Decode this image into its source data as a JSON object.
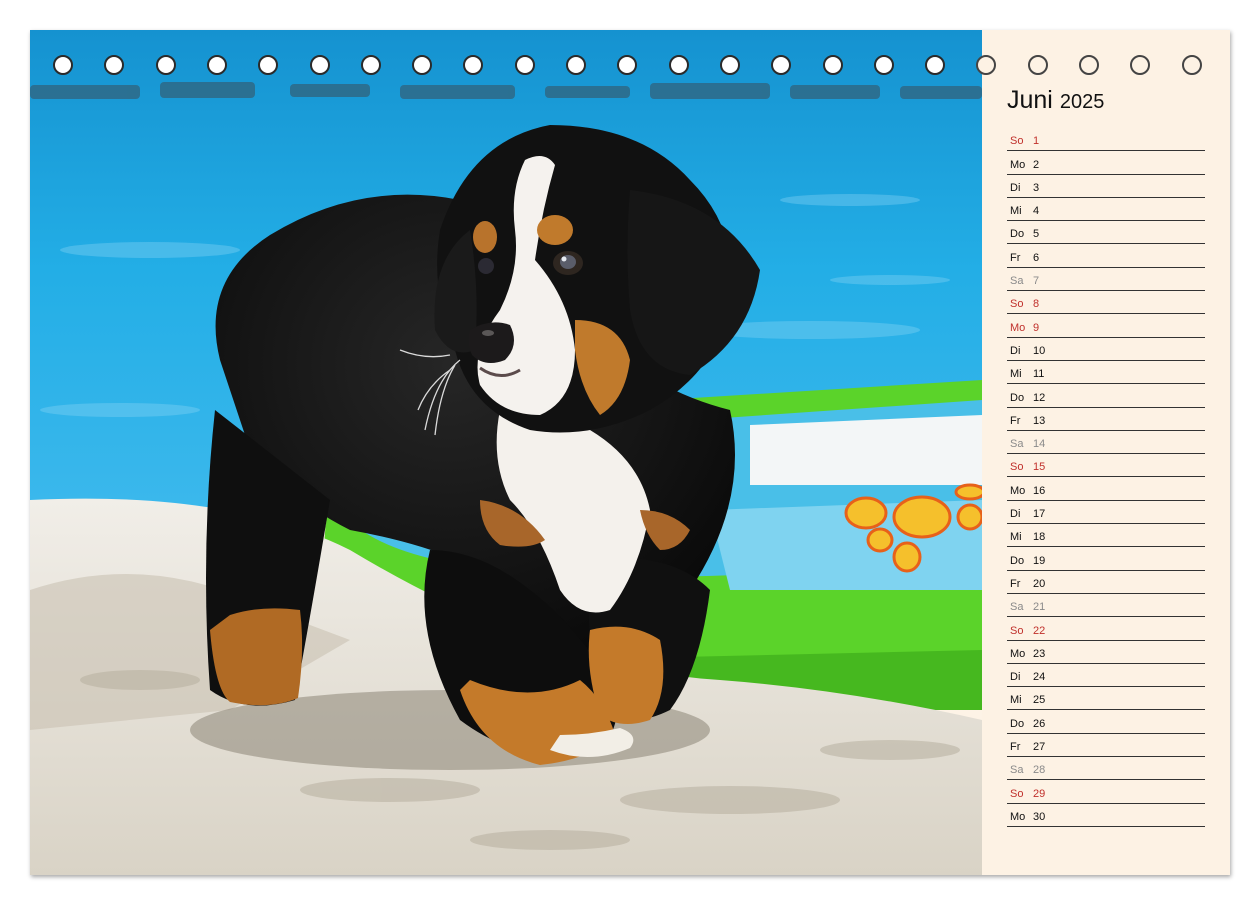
{
  "photo": {
    "subject": "bernese-mountain-dog-puppy-on-beach",
    "colors": {
      "sea": "#1ea7e1",
      "sand": "#e7e2d8",
      "float_green": "#5bd32a",
      "float_blue": "#45c2ea",
      "fur_black": "#121212",
      "fur_tan": "#b4691e",
      "fur_white": "#f4f1ec"
    }
  },
  "calendar": {
    "month": "Juni",
    "year": "2025",
    "colors": {
      "sunday": "#c0302b",
      "saturday": "#8a8a8a",
      "weekday": "#111111",
      "paper": "#fdf2e4"
    },
    "days": [
      {
        "wd": "So",
        "num": "1",
        "kind": "sunday"
      },
      {
        "wd": "Mo",
        "num": "2",
        "kind": "normal"
      },
      {
        "wd": "Di",
        "num": "3",
        "kind": "normal"
      },
      {
        "wd": "Mi",
        "num": "4",
        "kind": "normal"
      },
      {
        "wd": "Do",
        "num": "5",
        "kind": "normal"
      },
      {
        "wd": "Fr",
        "num": "6",
        "kind": "normal"
      },
      {
        "wd": "Sa",
        "num": "7",
        "kind": "saturday"
      },
      {
        "wd": "So",
        "num": "8",
        "kind": "sunday"
      },
      {
        "wd": "Mo",
        "num": "9",
        "kind": "sunday"
      },
      {
        "wd": "Di",
        "num": "10",
        "kind": "normal"
      },
      {
        "wd": "Mi",
        "num": "11",
        "kind": "normal"
      },
      {
        "wd": "Do",
        "num": "12",
        "kind": "normal"
      },
      {
        "wd": "Fr",
        "num": "13",
        "kind": "normal"
      },
      {
        "wd": "Sa",
        "num": "14",
        "kind": "saturday"
      },
      {
        "wd": "So",
        "num": "15",
        "kind": "sunday"
      },
      {
        "wd": "Mo",
        "num": "16",
        "kind": "normal"
      },
      {
        "wd": "Di",
        "num": "17",
        "kind": "normal"
      },
      {
        "wd": "Mi",
        "num": "18",
        "kind": "normal"
      },
      {
        "wd": "Do",
        "num": "19",
        "kind": "normal"
      },
      {
        "wd": "Fr",
        "num": "20",
        "kind": "normal"
      },
      {
        "wd": "Sa",
        "num": "21",
        "kind": "saturday"
      },
      {
        "wd": "So",
        "num": "22",
        "kind": "sunday"
      },
      {
        "wd": "Mo",
        "num": "23",
        "kind": "normal"
      },
      {
        "wd": "Di",
        "num": "24",
        "kind": "normal"
      },
      {
        "wd": "Mi",
        "num": "25",
        "kind": "normal"
      },
      {
        "wd": "Do",
        "num": "26",
        "kind": "normal"
      },
      {
        "wd": "Fr",
        "num": "27",
        "kind": "normal"
      },
      {
        "wd": "Sa",
        "num": "28",
        "kind": "saturday"
      },
      {
        "wd": "So",
        "num": "29",
        "kind": "sunday"
      },
      {
        "wd": "Mo",
        "num": "30",
        "kind": "normal"
      }
    ]
  }
}
